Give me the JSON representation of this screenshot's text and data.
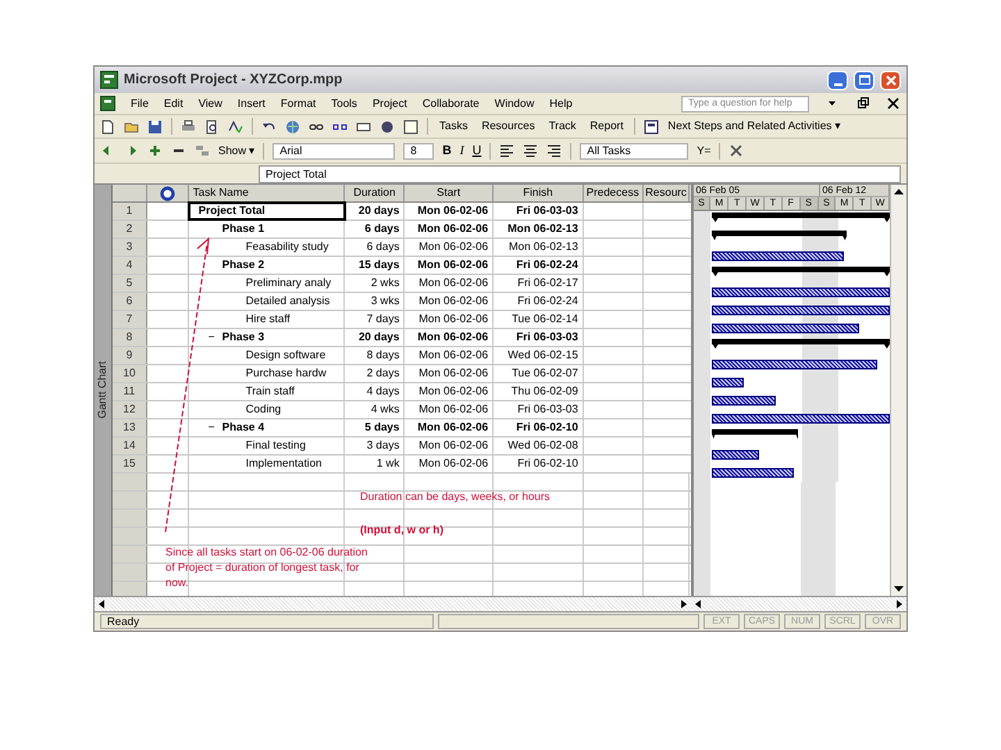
{
  "window": {
    "title": "Microsoft Project - XYZCorp.mpp"
  },
  "menu": [
    "File",
    "Edit",
    "View",
    "Insert",
    "Format",
    "Tools",
    "Project",
    "Collaborate",
    "Window",
    "Help"
  ],
  "help_box": {
    "placeholder": "Type a question for help"
  },
  "toolbar_1": {
    "buttons": [
      "Tasks",
      "Resources",
      "Track",
      "Report"
    ],
    "guide": "Next Steps and Related Activities ▾"
  },
  "toolbar_2": {
    "show": "Show ▾",
    "font": "Arial",
    "size": "8",
    "bold": "B",
    "italic": "I",
    "underline": "U",
    "filter": "All Tasks",
    "autofilter": "Y="
  },
  "entry_bar": {
    "value": "Project Total"
  },
  "view_bar": {
    "label": "Gantt Chart"
  },
  "table": {
    "columns": [
      "Task Name",
      "Duration",
      "Start",
      "Finish",
      "Predecess",
      "Resourc"
    ],
    "tasks": [
      {
        "id": "1",
        "name": "Project Total",
        "duration": "20 days",
        "start": "Mon 06-02-06",
        "finish": "Fri 06-03-03",
        "selected": true,
        "bar": {
          "level": 1
        },
        "children": [
          {
            "id": "2",
            "name": "Phase 1",
            "duration": "6 days",
            "start": "Mon 06-02-06",
            "finish": "Mon 06-02-13",
            "selected": false,
            "bar": {
              "level": 0.76
            },
            "children": [
              {
                "id": "3",
                "name": "Feasability study",
                "duration": "6 days",
                "start": "Mon 06-02-06",
                "finish": "Mon 06-02-13",
                "selected": false,
                "bar": {
                  "level": 0.74
                }
              }
            ]
          },
          {
            "id": "4",
            "name": "Phase 2",
            "duration": "15 days",
            "start": "Mon 06-02-06",
            "finish": "Fri 06-02-24",
            "selected": false,
            "bar": {
              "level": 1
            },
            "children": [
              {
                "id": "5",
                "name": "Preliminary analy",
                "duration": "2 wks",
                "start": "Mon 06-02-06",
                "finish": "Fri 06-02-17",
                "selected": false,
                "bar": {
                  "level": 1
                }
              },
              {
                "id": "6",
                "name": "Detailed analysis",
                "duration": "3 wks",
                "start": "Mon 06-02-06",
                "finish": "Fri 06-02-24",
                "selected": false,
                "bar": {
                  "level": 1
                }
              },
              {
                "id": "7",
                "name": "Hire staff",
                "duration": "7 days",
                "start": "Mon 06-02-06",
                "finish": "Tue 06-02-14",
                "selected": false,
                "bar": {
                  "level": 0.83
                }
              }
            ]
          },
          {
            "id": "8",
            "name": "Phase 3",
            "toggle": "−",
            "duration": "20 days",
            "start": "Mon 06-02-06",
            "finish": "Fri 06-03-03",
            "selected": false,
            "bar": {
              "level": 1
            },
            "children": [
              {
                "id": "9",
                "name": "Design software",
                "duration": "8 days",
                "start": "Mon 06-02-06",
                "finish": "Wed 06-02-15",
                "selected": false,
                "bar": {
                  "level": 0.93
                }
              },
              {
                "id": "10",
                "name": "Purchase hardw",
                "duration": "2 days",
                "start": "Mon 06-02-06",
                "finish": "Tue 06-02-07",
                "selected": false,
                "bar": {
                  "level": 0.18
                }
              },
              {
                "id": "11",
                "name": "Train staff",
                "duration": "4 days",
                "start": "Mon 06-02-06",
                "finish": "Thu 06-02-09",
                "selected": false,
                "bar": {
                  "level": 0.36
                }
              },
              {
                "id": "12",
                "name": "Coding",
                "duration": "4 wks",
                "start": "Mon 06-02-06",
                "finish": "Fri 06-03-03",
                "selected": false,
                "bar": {
                  "level": 1
                }
              }
            ]
          },
          {
            "id": "13",
            "name": "Phase 4",
            "toggle": "−",
            "duration": "5 days",
            "start": "Mon 06-02-06",
            "finish": "Fri 06-02-10",
            "selected": false,
            "bar": {
              "level": 0.49
            },
            "children": [
              {
                "id": "14",
                "name": "Final testing",
                "duration": "3 days",
                "start": "Mon 06-02-06",
                "finish": "Wed 06-02-08",
                "selected": false,
                "bar": {
                  "level": 0.27
                }
              },
              {
                "id": "15",
                "name": "Implementation",
                "duration": "1 wk",
                "start": "Mon 06-02-06",
                "finish": "Fri 06-02-10",
                "selected": false,
                "bar": {
                  "level": 0.46
                }
              }
            ]
          }
        ]
      }
    ]
  },
  "timescale": {
    "weeks": [
      "06 Feb 05",
      "06 Feb 12"
    ],
    "days": [
      {
        "label": "S",
        "weekend": true
      },
      {
        "label": "M",
        "weekend": false
      },
      {
        "label": "T",
        "weekend": false
      },
      {
        "label": "W",
        "weekend": false
      },
      {
        "label": "T",
        "weekend": false
      },
      {
        "label": "F",
        "weekend": false
      },
      {
        "label": "S",
        "weekend": true
      },
      {
        "label": "S",
        "weekend": true
      },
      {
        "label": "M",
        "weekend": false
      },
      {
        "label": "T",
        "weekend": false
      },
      {
        "label": "W",
        "weekend": false
      }
    ]
  },
  "annotations": {
    "duration_note": "Duration can be days, weeks, or hours",
    "input_note": "(Input d, w or h)",
    "start_note": "Since all tasks start on 06-02-06 duration of Project = duration of longest task, for now."
  },
  "status_bar": {
    "text": "Ready",
    "indicators": [
      "EXT",
      "CAPS",
      "NUM",
      "SCRL",
      "OVR"
    ]
  }
}
